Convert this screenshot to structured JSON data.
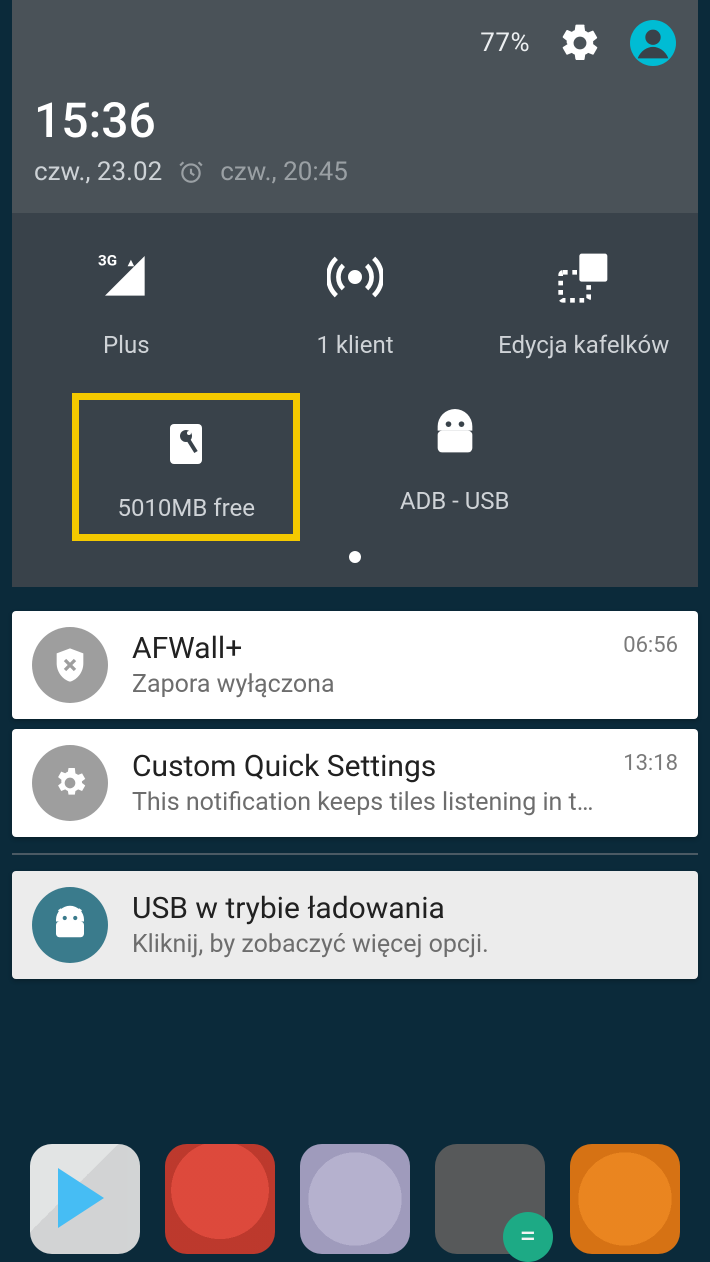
{
  "status": {
    "battery": "77%",
    "time": "15:36",
    "date": "czw., 23.02",
    "alarm": "czw., 20:45"
  },
  "tiles": {
    "row1": [
      {
        "label": "Plus"
      },
      {
        "label": "1 klient"
      },
      {
        "label": "Edycja kafelków"
      }
    ],
    "row2": [
      {
        "label": "5010MB free"
      },
      {
        "label": "ADB - USB"
      }
    ],
    "signal_badge": "3G"
  },
  "notifications": [
    {
      "title": "AFWall+",
      "text": "Zapora wyłączona",
      "time": "06:56",
      "icon": "shield-x"
    },
    {
      "title": "Custom Quick Settings",
      "text": "This notification keeps tiles listening in the..",
      "time": "13:18",
      "icon": "gear"
    },
    {
      "title": "USB w trybie ładowania",
      "text": "Kliknij, by zobaczyć więcej opcji.",
      "time": "",
      "icon": "cyanogen"
    }
  ]
}
